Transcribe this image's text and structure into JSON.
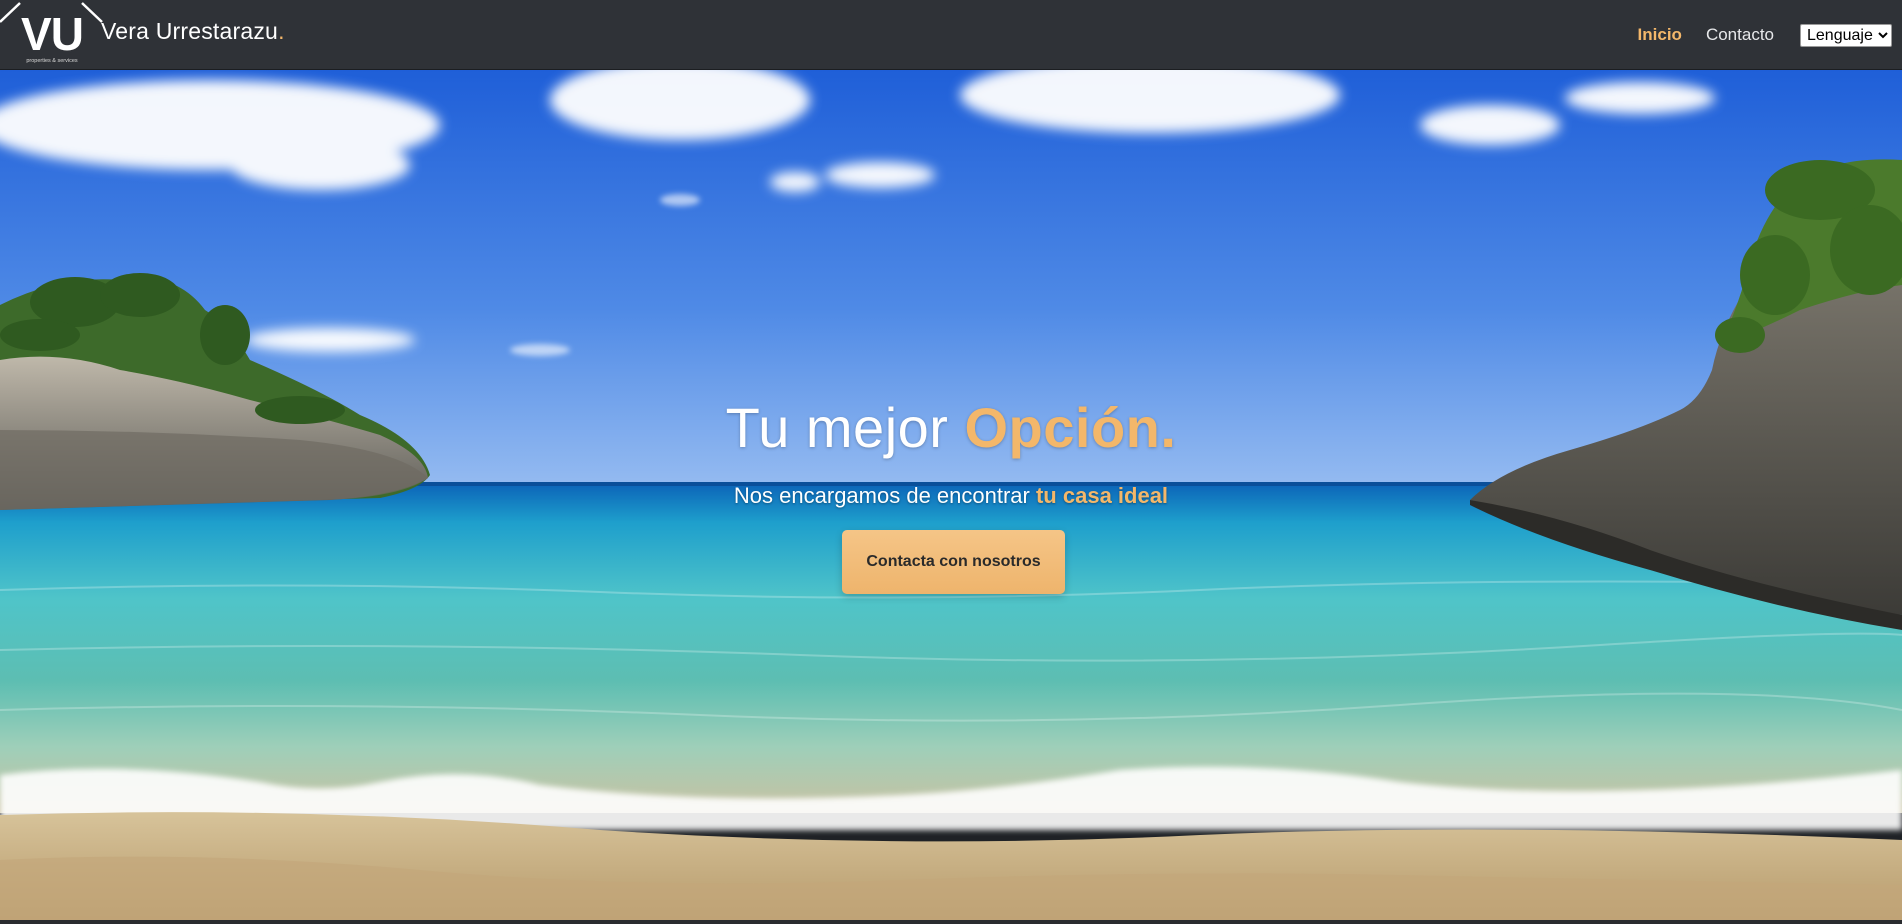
{
  "navbar": {
    "brand_name": "Vera Urrestarazu",
    "brand_dot": ".",
    "logo_initials": "VU",
    "logo_tagline": "properties & services",
    "links": [
      {
        "label": "Inicio",
        "active": true
      },
      {
        "label": "Contacto",
        "active": false
      }
    ],
    "language_select": {
      "selected": "Lenguaje",
      "options": [
        "Lenguaje"
      ]
    }
  },
  "hero": {
    "title_plain": "Tu mejor ",
    "title_accent": "Opción.",
    "subtitle_plain": "Nos encargamos de encontrar ",
    "subtitle_accent": "tu casa ideal",
    "cta_label": "Contacta con nosotros",
    "background_scene": "beach-cove-image"
  },
  "colors": {
    "accent": "#f3b76a",
    "navbar_bg": "#2f3237",
    "text_light": "#ffffff"
  }
}
